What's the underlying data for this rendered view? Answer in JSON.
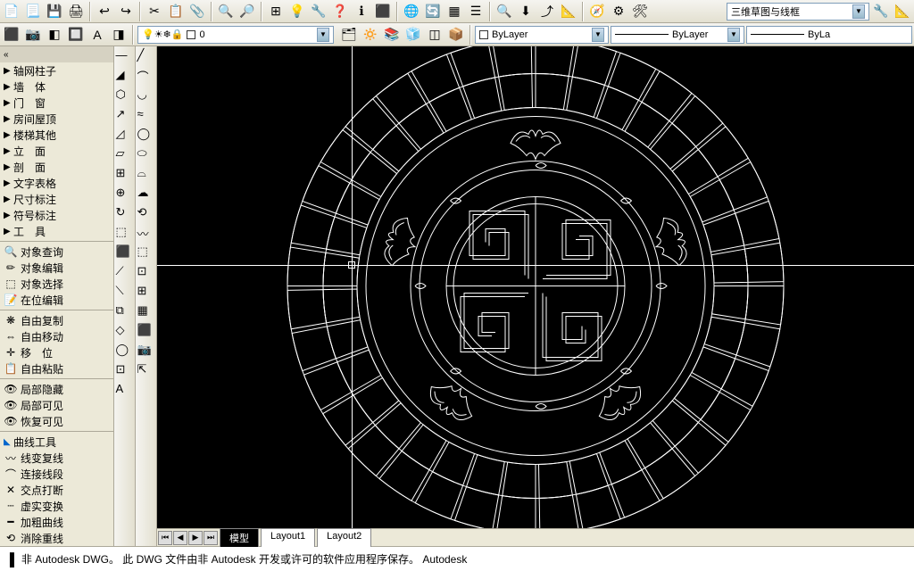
{
  "toolbar1_icons": [
    "📄",
    "📃",
    "💾",
    "🖨",
    "↩",
    "↪",
    "✂",
    "📋",
    "📎",
    "🔍",
    "🔎",
    "⊞",
    "💡",
    "🔧",
    "❓",
    "ℹ",
    "⬛",
    "🌐",
    "🔄",
    "▦",
    "☰",
    "🔍",
    "⬇",
    "⤴",
    "📐",
    "🧭",
    "⚙",
    "🛠"
  ],
  "toolbar2_icons": [
    "⬛",
    "📷",
    "◧",
    "🔲",
    "A",
    "◨"
  ],
  "layer_panel": {
    "light_icons": "💡☀❄🔒",
    "current": "0",
    "color_swatch": "#ffffff"
  },
  "dropdowns": {
    "bylayer1": "ByLayer",
    "bylayer2": "ByLayer",
    "bylayer3": "ByLa",
    "viewstyle": "三维草图与线框"
  },
  "layer_icons_row2": [
    "🗂",
    "🔅",
    "📚",
    "🧊",
    "◫",
    "📦"
  ],
  "color_swatch_border": "□",
  "left_tree": [
    {
      "arrow": "▶",
      "label": "轴网柱子"
    },
    {
      "arrow": "▶",
      "label": "墙　体"
    },
    {
      "arrow": "▶",
      "label": "门　窗"
    },
    {
      "arrow": "▶",
      "label": "房间屋顶"
    },
    {
      "arrow": "▶",
      "label": "楼梯其他"
    },
    {
      "arrow": "▶",
      "label": "立　面"
    },
    {
      "arrow": "▶",
      "label": "剖　面"
    },
    {
      "arrow": "▶",
      "label": "文字表格"
    },
    {
      "arrow": "▶",
      "label": "尺寸标注"
    },
    {
      "arrow": "▶",
      "label": "符号标注"
    },
    {
      "arrow": "▶",
      "label": "工　具"
    }
  ],
  "left_tools1": [
    {
      "icon": "🔍",
      "label": "对象查询"
    },
    {
      "icon": "✏",
      "label": "对象编辑"
    },
    {
      "icon": "⬚",
      "label": "对象选择"
    },
    {
      "icon": "📝",
      "label": "在位编辑"
    }
  ],
  "left_tools2": [
    {
      "icon": "❋",
      "label": "自由复制"
    },
    {
      "icon": "⇔",
      "label": "自由移动"
    },
    {
      "icon": "✛",
      "label": "移　位"
    },
    {
      "icon": "📋",
      "label": "自由粘贴"
    }
  ],
  "left_tools3": [
    {
      "icon": "👁",
      "label": "局部隐藏"
    },
    {
      "icon": "👁",
      "label": "局部可见"
    },
    {
      "icon": "👁",
      "label": "恢复可见"
    }
  ],
  "left_tools4_header": {
    "arrow": "◣",
    "label": "曲线工具"
  },
  "left_tools4": [
    {
      "icon": "〰",
      "label": "线变复线"
    },
    {
      "icon": "⌒",
      "label": "连接线段"
    },
    {
      "icon": "✕",
      "label": "交点打断"
    },
    {
      "icon": "┄",
      "label": "虚实变换"
    },
    {
      "icon": "━",
      "label": "加粗曲线"
    },
    {
      "icon": "⟲",
      "label": "消除重线"
    }
  ],
  "strip_a_icons": [
    "—",
    "◢",
    "⬡",
    "↗",
    "◿",
    "▱",
    "⊞",
    "⊕",
    "↻",
    "⬚",
    "⬛",
    "⟋",
    "⟍",
    "⧉",
    "◇",
    "◯",
    "⊡",
    "A"
  ],
  "strip_b_icons": [
    "╱",
    "⌒",
    "◡",
    "≈",
    "◯",
    "⬭",
    "⌓",
    "☁",
    "⟲",
    "〰",
    "⬚",
    "⊡",
    "⊞",
    "▦",
    "⬛",
    "📷",
    "⇱"
  ],
  "tabs": {
    "nav": [
      "⏮",
      "◀",
      "▶",
      "⏭"
    ],
    "items": [
      {
        "label": "模型",
        "active": true
      },
      {
        "label": "Layout1",
        "active": false
      },
      {
        "label": "Layout2",
        "active": false
      }
    ]
  },
  "commandline": "非 Autodesk DWG。  此 DWG 文件由非 Autodesk 开发或许可的软件应用程序保存。  Autodesk"
}
